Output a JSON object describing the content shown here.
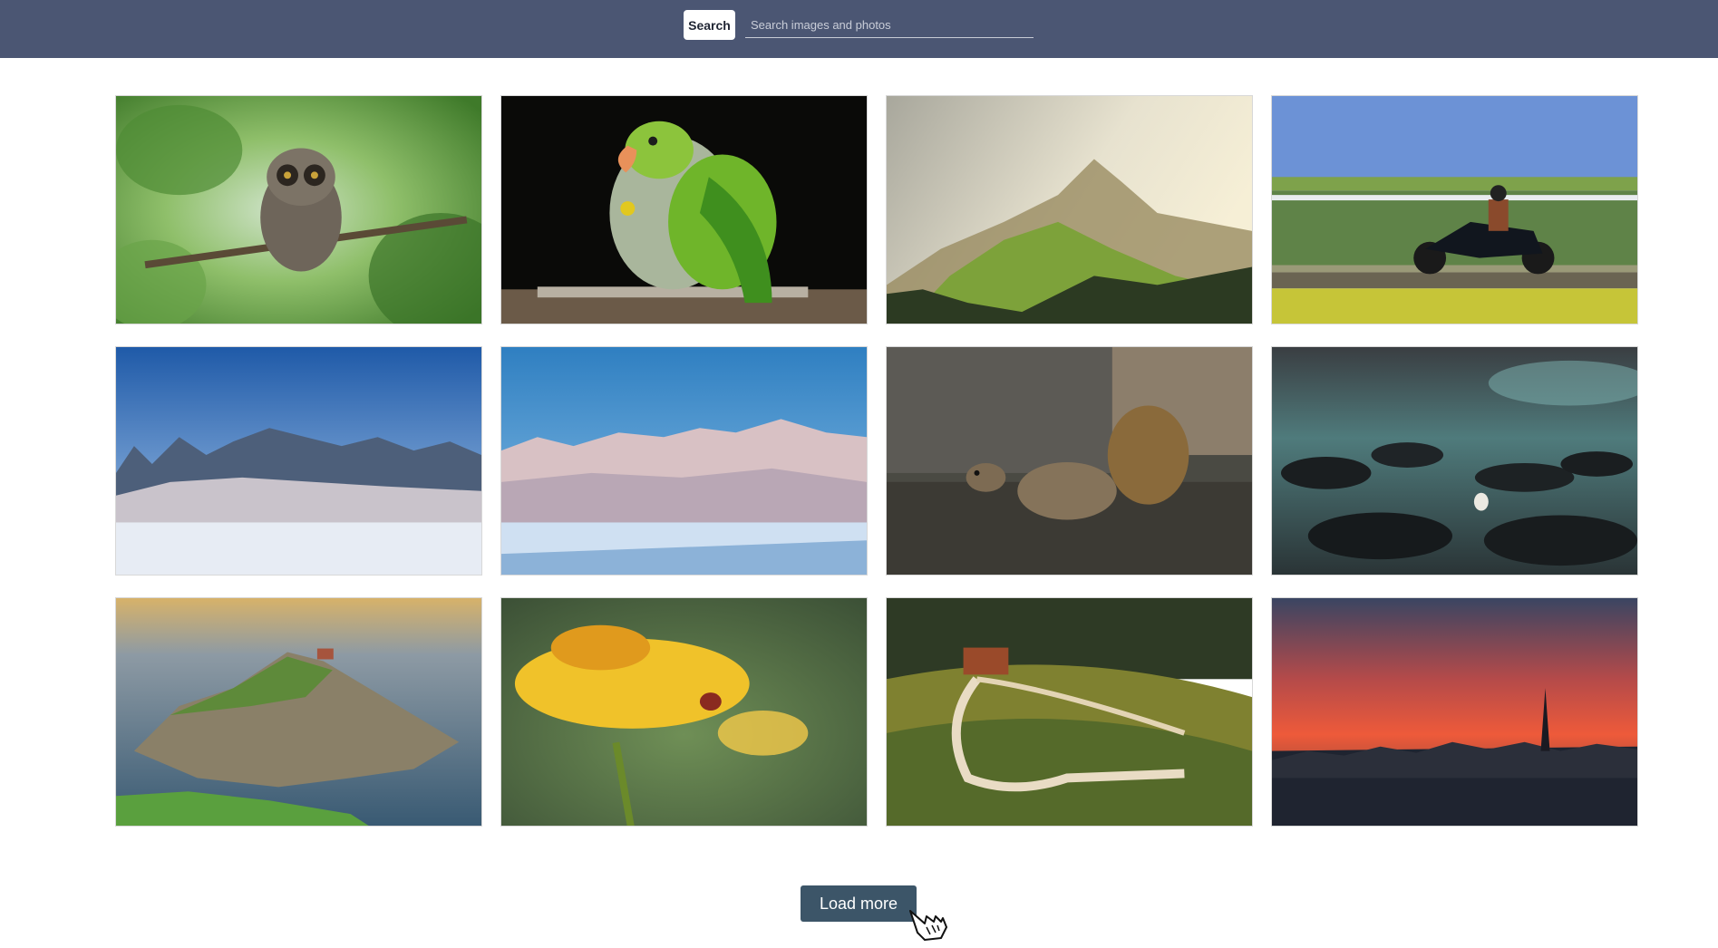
{
  "header": {
    "search_button_label": "Search",
    "search_placeholder": "Search images and photos",
    "search_value": ""
  },
  "gallery": {
    "images": [
      {
        "subject": "owl-on-branch"
      },
      {
        "subject": "green-parrot"
      },
      {
        "subject": "misty-mountain"
      },
      {
        "subject": "motorcycle-rider"
      },
      {
        "subject": "snowy-forest-field"
      },
      {
        "subject": "frosted-bushes"
      },
      {
        "subject": "squirrel"
      },
      {
        "subject": "rocky-shore-seagull"
      },
      {
        "subject": "island-chapel-coast"
      },
      {
        "subject": "yellow-flower-ladybug"
      },
      {
        "subject": "vineyard-road-house"
      },
      {
        "subject": "paris-sunset-skyline"
      }
    ]
  },
  "footer": {
    "load_more_label": "Load more"
  },
  "colors": {
    "header_bg": "#4b5673",
    "button_bg": "#3c5568"
  }
}
